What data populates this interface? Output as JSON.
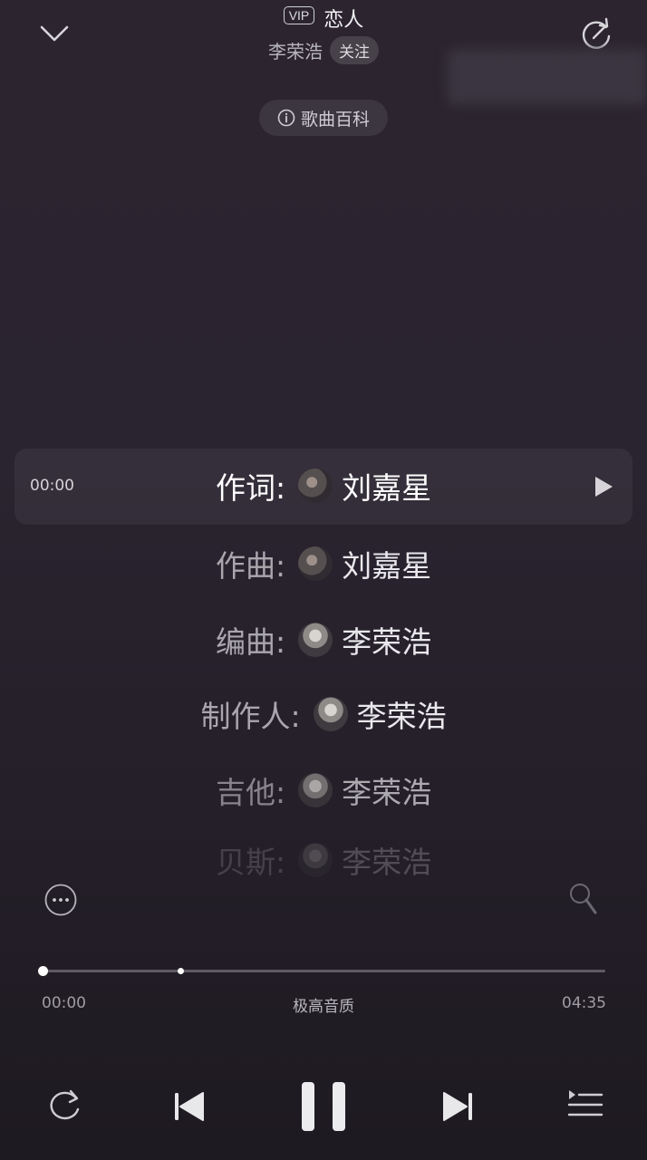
{
  "header": {
    "vip_badge": "VIP",
    "song_title": "恋人",
    "artist": "李荣浩",
    "follow_label": "关注",
    "wiki_label": "歌曲百科"
  },
  "credits": {
    "current_time": "00:00",
    "lines": [
      {
        "role": "作词:",
        "person": "刘嘉星"
      },
      {
        "role": "作曲:",
        "person": "刘嘉星"
      },
      {
        "role": "编曲:",
        "person": "李荣浩"
      },
      {
        "role": "制作人:",
        "person": "李荣浩"
      },
      {
        "role": "吉他:",
        "person": "李荣浩"
      },
      {
        "role": "贝斯:",
        "person": "李荣浩"
      }
    ]
  },
  "player": {
    "progress": 0,
    "elapsed": "00:00",
    "duration": "04:35",
    "quality": "极高音质",
    "state": "playing"
  },
  "icons": {
    "collapse": "chevron-down-icon",
    "share": "share-refresh-icon",
    "wiki": "info-icon",
    "play_line": "play-icon",
    "more": "more-icon",
    "mic": "mic-icon",
    "repeat": "repeat-icon",
    "prev": "previous-icon",
    "pause": "pause-icon",
    "next": "next-icon",
    "queue": "playlist-icon"
  }
}
